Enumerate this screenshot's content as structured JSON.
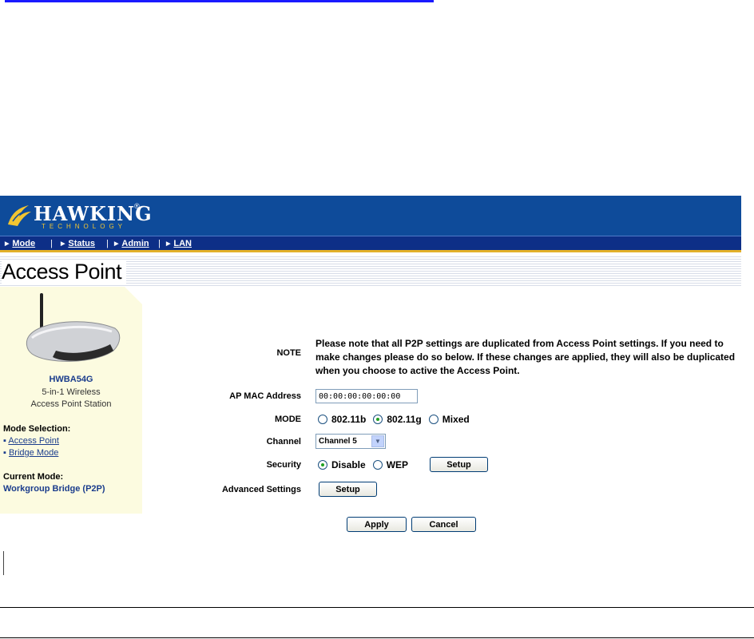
{
  "brand": {
    "name": "HAWKING",
    "subtitle": "TECHNOLOGY",
    "registered": "®",
    "icon": "hawk-logo-icon",
    "banner_color": "#0e4b9a",
    "nav_color": "#0d2f87",
    "accent_color": "#e3b12a"
  },
  "nav": {
    "items": [
      {
        "label": "Mode"
      },
      {
        "label": "Status"
      },
      {
        "label": "Admin"
      },
      {
        "label": "LAN"
      }
    ],
    "separator": "|",
    "arrow": "▶"
  },
  "page": {
    "title": "Access Point"
  },
  "sidebar": {
    "device_icon": "wireless-router-icon",
    "model": "HWBA54G",
    "desc_line1": "5-in-1 Wireless",
    "desc_line2": "Access Point Station",
    "mode_selection_heading": "Mode Selection:",
    "links": [
      {
        "bullet": "▪",
        "label": "Access Point"
      },
      {
        "bullet": "▪",
        "label": "Bridge Mode"
      }
    ],
    "current_mode_heading": "Current Mode:",
    "current_mode_value": "Workgroup Bridge (P2P)",
    "background": "#fcfbe0"
  },
  "form": {
    "note_label": "NOTE",
    "note_text": "Please note that all P2P settings are duplicated from Access Point settings. If you need to make changes please do so below. If these changes are applied, they will also be duplicated when you choose to active the Access Point.",
    "ap_mac_label": "AP MAC Address",
    "ap_mac_value": "00:00:00:00:00:00",
    "mode_label": "MODE",
    "mode_options": [
      {
        "label": "802.11b",
        "selected": false
      },
      {
        "label": "802.11g",
        "selected": true
      },
      {
        "label": "Mixed",
        "selected": false
      }
    ],
    "channel_label": "Channel",
    "channel_value": "Channel 5",
    "security_label": "Security",
    "security_options": [
      {
        "label": "Disable",
        "selected": true
      },
      {
        "label": "WEP",
        "selected": false
      }
    ],
    "security_setup_label": "Setup",
    "advanced_label": "Advanced Settings",
    "advanced_setup_label": "Setup",
    "apply_label": "Apply",
    "cancel_label": "Cancel"
  }
}
